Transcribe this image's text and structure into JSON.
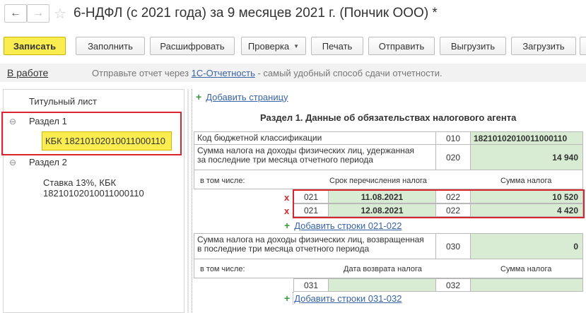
{
  "window": {
    "title": "6-НДФЛ (с 2021 года) за 9 месяцев 2021 г. (Пончик ООО) *",
    "back_glyph": "←",
    "forward_glyph": "→",
    "star_glyph": "☆"
  },
  "toolbar": {
    "save_label": "Записать",
    "fill_label": "Заполнить",
    "decode_label": "Расшифровать",
    "check_label": "Проверка",
    "print_label": "Печать",
    "send_label": "Отправить",
    "export_label": "Выгрузить",
    "import_label": "Загрузить"
  },
  "infobar": {
    "status": "В работе",
    "text_before": "Отправьте отчет через ",
    "link": "1С-Отчетность",
    "text_after": " - самый удобный способ сдачи отчетности."
  },
  "tree": {
    "title_sheet": "Титульный лист",
    "section1": "Раздел 1",
    "section1_kbk": "КБК 18210102010011000110",
    "section2": "Раздел 2",
    "section2_line1": "Ставка 13%, КБК",
    "section2_line2": "18210102010011000110",
    "collapse_glyph": "⊖"
  },
  "form": {
    "add_page": "Добавить страницу",
    "section_title": "Раздел 1. Данные об обязательствах налогового агента",
    "kbk_label": "Код бюджетной классификации",
    "kbk_code": "010",
    "kbk_value": "18210102010011000110",
    "withheld_label_1": "Сумма налога на доходы физических лиц, удержанная",
    "withheld_label_2": "за последние три месяца отчетного периода",
    "withheld_code": "020",
    "withheld_value": "14 940",
    "including": "в том числе:",
    "col_transfer_date": "Срок перечисления налога",
    "col_tax_sum": "Сумма налога",
    "rows_021": [
      {
        "code_a": "021",
        "date": "11.08.2021",
        "code_b": "022",
        "sum": "10 520"
      },
      {
        "code_a": "021",
        "date": "12.08.2021",
        "code_b": "022",
        "sum": "4 420"
      }
    ],
    "delete_glyph": "x",
    "add_rows_021": "Добавить строки 021-022",
    "returned_label_1": "Сумма налога на доходы физических лиц, возвращенная",
    "returned_label_2": "в последние три месяца отчетного периода",
    "returned_code": "030",
    "returned_value": "0",
    "including_2": "в том числе:",
    "col_return_date": "Дата возврата налога",
    "col_tax_sum_2": "Сумма налога",
    "row_031": {
      "code_a": "031",
      "date": "",
      "code_b": "032",
      "sum": ""
    },
    "add_rows_031": "Добавить строки 031-032"
  },
  "colors": {
    "accent_yellow": "#fbed4f",
    "highlight_red": "#d9262e",
    "field_green": "#d8ecd4",
    "link_blue": "#3a64a8"
  }
}
